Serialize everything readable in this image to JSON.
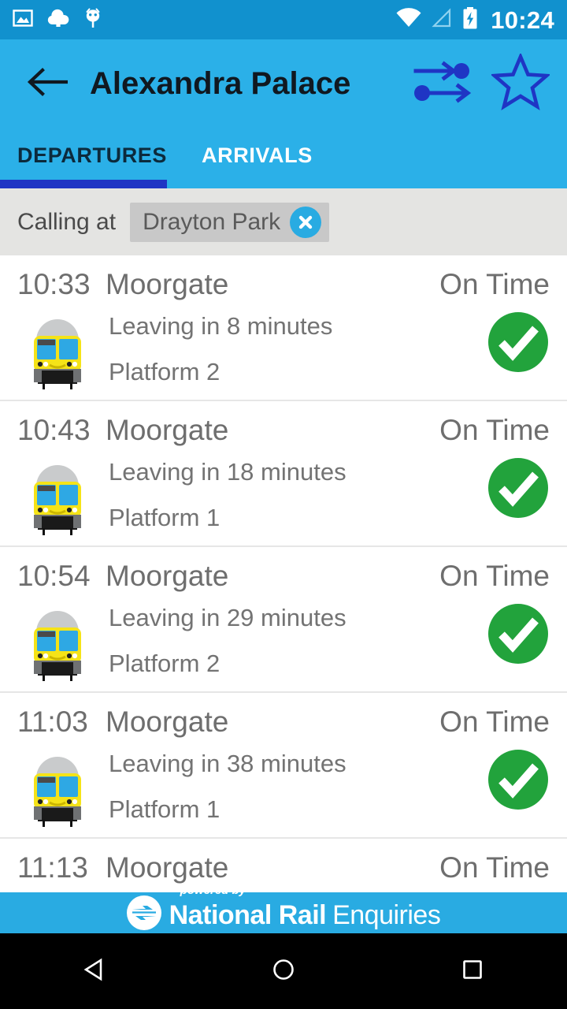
{
  "status_bar": {
    "time": "10:24",
    "left_icons": [
      "image-icon",
      "cloud-upload-icon",
      "android-debug-icon"
    ],
    "right_icons": [
      "wifi-icon",
      "signal-icon",
      "battery-charging-icon"
    ],
    "background": "#1191ce"
  },
  "header": {
    "title": "Alexandra Palace",
    "back_icon": "back-arrow-icon",
    "actions": [
      "journey-planner-icon",
      "favourite-star-icon"
    ],
    "background": "#2bb0e8",
    "title_color": "#101820"
  },
  "tabs": {
    "items": [
      {
        "label": "DEPARTURES",
        "active": true
      },
      {
        "label": "ARRIVALS",
        "active": false
      }
    ],
    "indicator_color": "#1f35c4"
  },
  "filter": {
    "label": "Calling at",
    "chip": {
      "text": "Drayton Park",
      "close_icon": "close-circle-icon",
      "background": "#c8c8c8",
      "close_color": "#29abe2"
    },
    "strip_background": "#e4e4e2"
  },
  "departures": [
    {
      "time": "10:33",
      "destination": "Moorgate",
      "status": "On Time",
      "leaving": "Leaving in 8 minutes",
      "platform": "Platform 2",
      "status_icon": "green-check-icon",
      "train_icon": "train-front-icon"
    },
    {
      "time": "10:43",
      "destination": "Moorgate",
      "status": "On Time",
      "leaving": "Leaving in 18 minutes",
      "platform": "Platform 1",
      "status_icon": "green-check-icon",
      "train_icon": "train-front-icon"
    },
    {
      "time": "10:54",
      "destination": "Moorgate",
      "status": "On Time",
      "leaving": "Leaving in 29 minutes",
      "platform": "Platform 2",
      "status_icon": "green-check-icon",
      "train_icon": "train-front-icon"
    },
    {
      "time": "11:03",
      "destination": "Moorgate",
      "status": "On Time",
      "leaving": "Leaving in 38 minutes",
      "platform": "Platform 1",
      "status_icon": "green-check-icon",
      "train_icon": "train-front-icon"
    },
    {
      "time": "11:13",
      "destination": "Moorgate",
      "status": "On Time",
      "leaving": "",
      "platform": "",
      "status_icon": "green-check-icon",
      "train_icon": "train-front-icon"
    }
  ],
  "footer": {
    "powered_by": "powered by",
    "brand_bold": "National Rail",
    "brand_light": "Enquiries",
    "logo_icon": "national-rail-logo-icon",
    "background": "#29abe2"
  },
  "nav_bar": {
    "buttons": [
      {
        "name": "back",
        "icon": "nav-back-triangle-icon"
      },
      {
        "name": "home",
        "icon": "nav-home-circle-icon"
      },
      {
        "name": "recents",
        "icon": "nav-recents-square-icon"
      }
    ],
    "background": "#000000"
  },
  "colors": {
    "status_green": "#22a33c",
    "accent_blue": "#29abe2",
    "indicator_blue": "#1f35c4",
    "row_text": "#6e6e6e",
    "row_subtext": "#737373"
  }
}
